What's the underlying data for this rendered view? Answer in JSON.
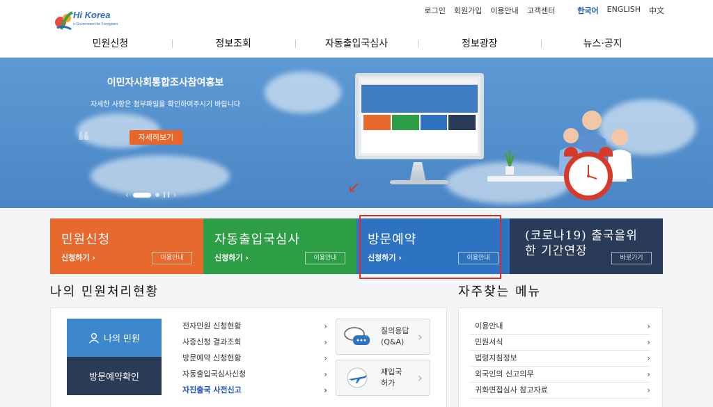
{
  "header": {
    "logo_text": "Hi Korea",
    "logo_sub": "e-Government for Foreigners",
    "util_links": [
      "로그인",
      "회원가입",
      "이용안내",
      "고객센터"
    ],
    "languages": [
      "한국어",
      "ENGLISH",
      "中文"
    ],
    "gnb": [
      "민원신청",
      "정보조회",
      "자동출입국심사",
      "정보광장",
      "뉴스·공지"
    ]
  },
  "hero": {
    "title": "이민자사회통합조사참여홍보",
    "subtitle": "자세한 사항은 첨부파일을 확인하여주시기 바랍니다",
    "button": "자세히보기"
  },
  "tiles": [
    {
      "title": "민원신청",
      "apply": "신청하기",
      "guide": "이용안내"
    },
    {
      "title": "자동출입국심사",
      "apply": "신청하기",
      "guide": "이용안내"
    },
    {
      "title": "방문예약",
      "apply": "신청하기",
      "guide": "이용안내"
    },
    {
      "title": "(코로나19) 출국을위한 기간연장",
      "line1": "(코로나19) 출국을위",
      "line2": "한 기간연장",
      "guide": "바로가기"
    }
  ],
  "my_status": {
    "title": "나의 민원처리현황",
    "my_civil": "나의 민원",
    "visit_confirm": "방문예약확인",
    "items": [
      "전자민원 신청현황",
      "사증신청 결과조회",
      "방문예약 신청현황",
      "자동출입국심사신청",
      "자진출국 사전신고"
    ],
    "qa": {
      "line1": "질의응답",
      "line2": "(Q&A)"
    },
    "reentry": {
      "line1": "재입국",
      "line2": "허가"
    }
  },
  "frequent": {
    "title": "자주찾는 메뉴",
    "items": [
      "이용안내",
      "민원서식",
      "법령지침정보",
      "외국인의 신고의무",
      "귀화면접심사 참고자료"
    ]
  },
  "colors": {
    "orange": "#e8692e",
    "green": "#2e9e46",
    "blue": "#2e72c2",
    "navy": "#2a3b5a",
    "hero_bg": "#4a86c6",
    "highlight": "#e02a2a"
  }
}
